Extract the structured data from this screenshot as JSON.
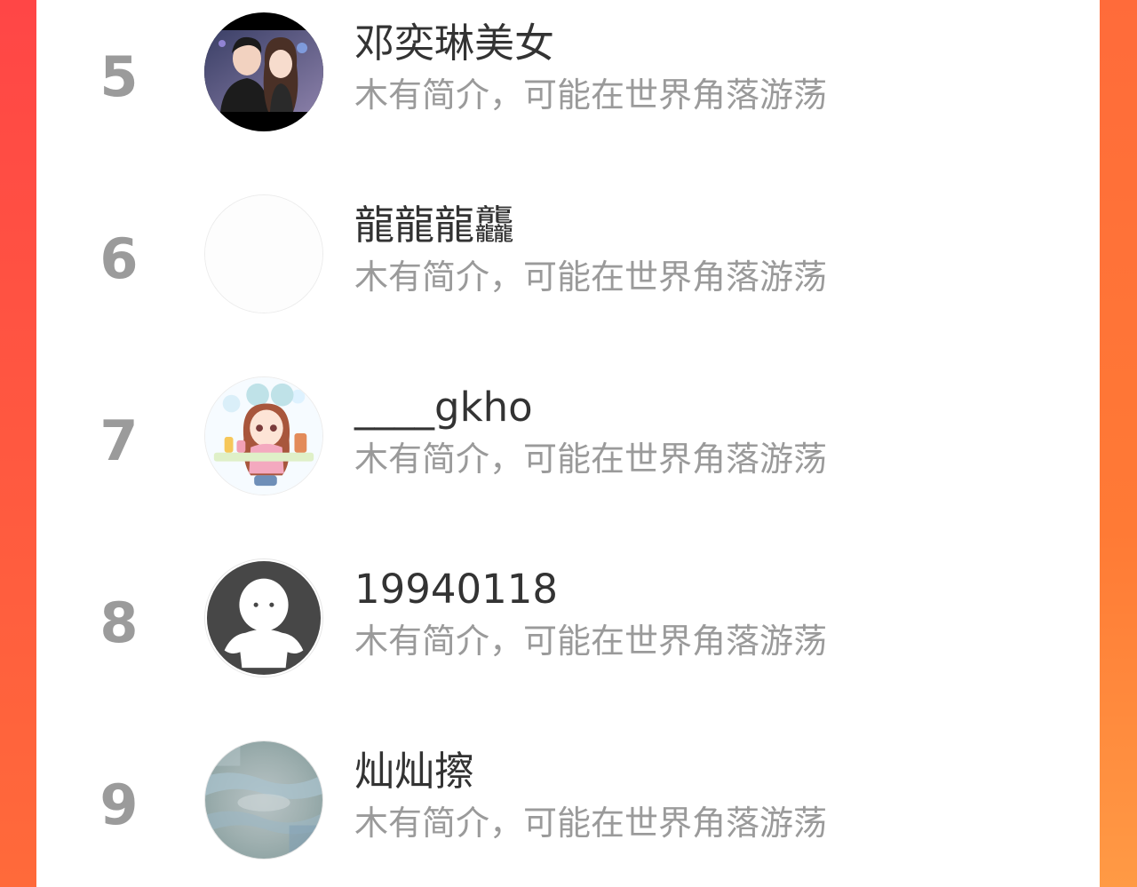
{
  "ranking": {
    "items": [
      {
        "rank": "5",
        "name": "邓奕琳美女",
        "description": "木有简介，可能在世界角落游荡",
        "avatar_icon": "couple-photo-avatar"
      },
      {
        "rank": "6",
        "name": "龍龍龍龘",
        "description": "木有简介，可能在世界角落游荡",
        "avatar_icon": "blank-avatar"
      },
      {
        "rank": "7",
        "name": "____gkho",
        "description": "木有简介，可能在世界角落游荡",
        "avatar_icon": "anime-girl-avatar"
      },
      {
        "rank": "8",
        "name": "19940118",
        "description": "木有简介，可能在世界角落游荡",
        "avatar_icon": "default-person-avatar"
      },
      {
        "rank": "9",
        "name": "灿灿擦",
        "description": "木有简介，可能在世界角落游荡",
        "avatar_icon": "water-ripple-avatar"
      }
    ]
  },
  "colors": {
    "accent_left": "#ff4646",
    "accent_right": "#ff7a35",
    "rank_text": "#9b9b9b",
    "name_text": "#333333",
    "description_text": "#9a9a9a"
  }
}
